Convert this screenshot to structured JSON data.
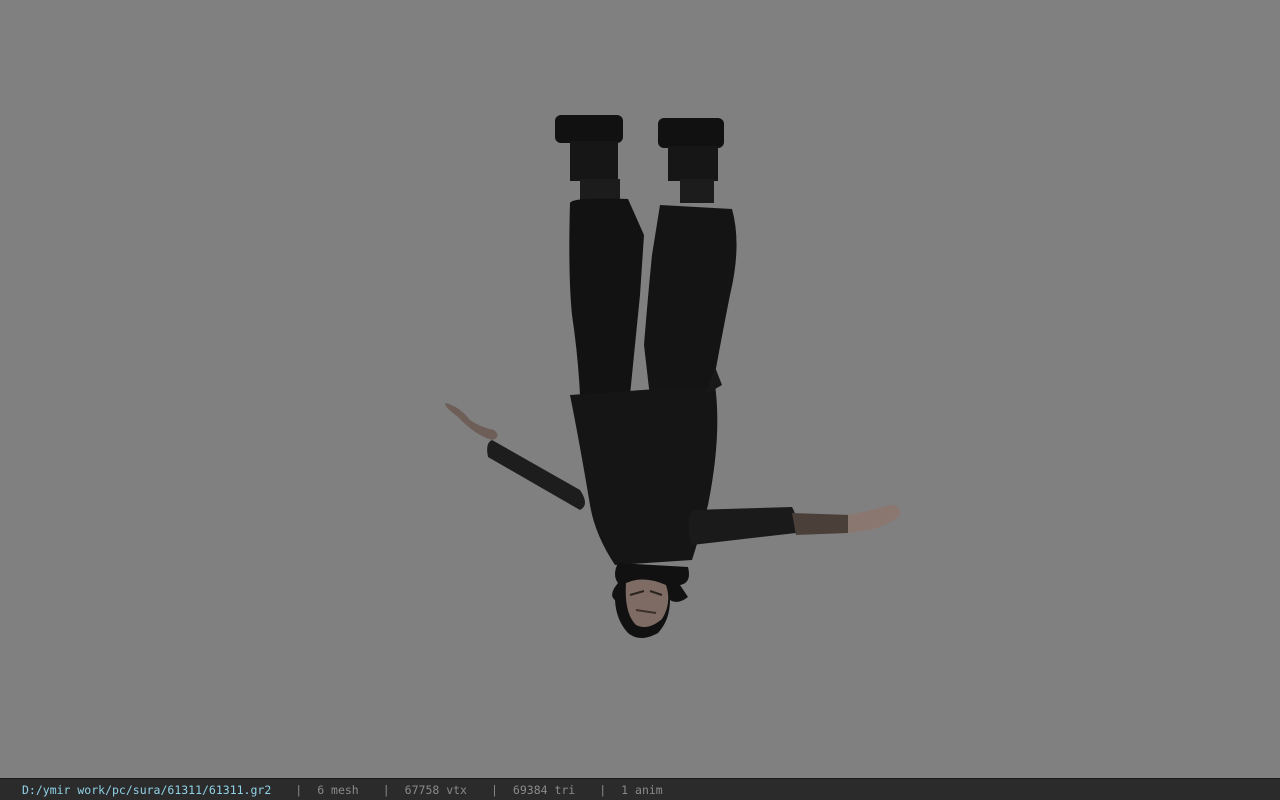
{
  "status_bar": {
    "file_path": "D:/ymir work/pc/sura/61311/61311.gr2",
    "separator": "|",
    "mesh_count": "6 mesh",
    "vertex_count": "67758 vtx",
    "triangle_count": "69384 tri",
    "anim_count": "1 anim"
  },
  "colors": {
    "viewport_background": "#808080",
    "statusbar_background": "#2b2b2b",
    "path_text": "#8fd2e8",
    "stat_text": "#8a8a8a"
  }
}
